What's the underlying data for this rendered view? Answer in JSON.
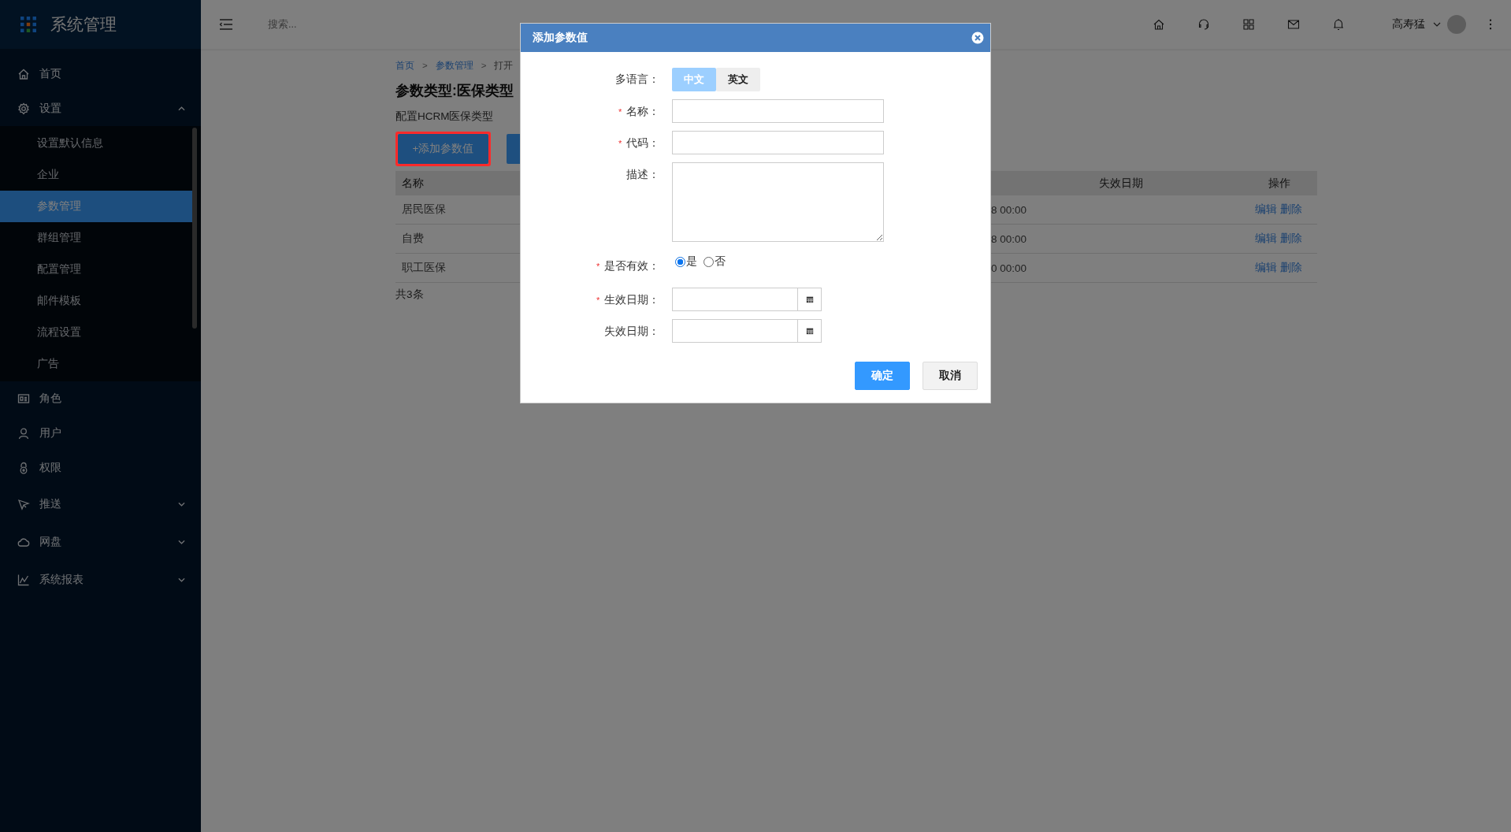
{
  "app": {
    "title": "系统管理"
  },
  "topbar": {
    "search": {
      "placeholder": "搜索..."
    },
    "user": {
      "name": "高寿猛"
    }
  },
  "sidebar": {
    "items": [
      {
        "label": "首页",
        "kind": "link"
      },
      {
        "label": "设置",
        "kind": "group",
        "expanded": true,
        "children": [
          {
            "label": "设置默认信息",
            "selected": false
          },
          {
            "label": "企业",
            "selected": false
          },
          {
            "label": "参数管理",
            "selected": true
          },
          {
            "label": "群组管理",
            "selected": false
          },
          {
            "label": "配置管理",
            "selected": false
          },
          {
            "label": "邮件模板",
            "selected": false
          },
          {
            "label": "流程设置",
            "selected": false
          },
          {
            "label": "广告",
            "selected": false
          }
        ]
      },
      {
        "label": "角色",
        "kind": "link"
      },
      {
        "label": "用户",
        "kind": "link"
      },
      {
        "label": "权限",
        "kind": "link"
      },
      {
        "label": "推送",
        "kind": "group",
        "expanded": false
      },
      {
        "label": "网盘",
        "kind": "group",
        "expanded": false
      },
      {
        "label": "系统报表",
        "kind": "group",
        "expanded": false
      }
    ]
  },
  "breadcrumb": [
    {
      "label": "首页",
      "link": true
    },
    {
      "label": "参数管理",
      "link": true,
      "separator": ">"
    },
    {
      "label": "打开",
      "link": false,
      "separator": ">"
    }
  ],
  "page": {
    "title": "参数类型:医保类型",
    "subtitle": "配置HCRM医保类型",
    "add_button": "+添加参数值"
  },
  "table": {
    "columns": [
      "名称",
      "失效日期",
      "操作"
    ],
    "rows": [
      {
        "name": "居民医保",
        "column_2": "8 00:00",
        "actions": [
          "编辑",
          "删除"
        ]
      },
      {
        "name": "自费",
        "column_2": "8 00:00",
        "actions": [
          "编辑",
          "删除"
        ]
      },
      {
        "name": "职工医保",
        "column_2": "0 00:00",
        "actions": [
          "编辑",
          "删除"
        ]
      }
    ],
    "total": "共3条"
  },
  "dialog": {
    "title": "添加参数值",
    "fields": [
      {
        "kind": "language",
        "label": "多语言：",
        "options": [
          {
            "label": "中文",
            "selected": true
          },
          {
            "label": "英文",
            "selected": false
          }
        ]
      },
      {
        "kind": "text",
        "label": "名称：",
        "mark": "*"
      },
      {
        "kind": "text",
        "label": "代码：",
        "mark": "*"
      },
      {
        "kind": "textarea",
        "label": "描述："
      },
      {
        "kind": "radio",
        "label": "是否有效：",
        "mark": "*",
        "options": [
          {
            "label": "是",
            "selected": true
          },
          {
            "label": "否",
            "selected": false
          }
        ]
      },
      {
        "kind": "date",
        "label": "生效日期：",
        "mark": "*"
      },
      {
        "kind": "date",
        "label": "失效日期："
      }
    ],
    "buttons": [
      {
        "label": "确定",
        "kind": "primary"
      },
      {
        "label": "取消",
        "kind": "default"
      }
    ]
  }
}
